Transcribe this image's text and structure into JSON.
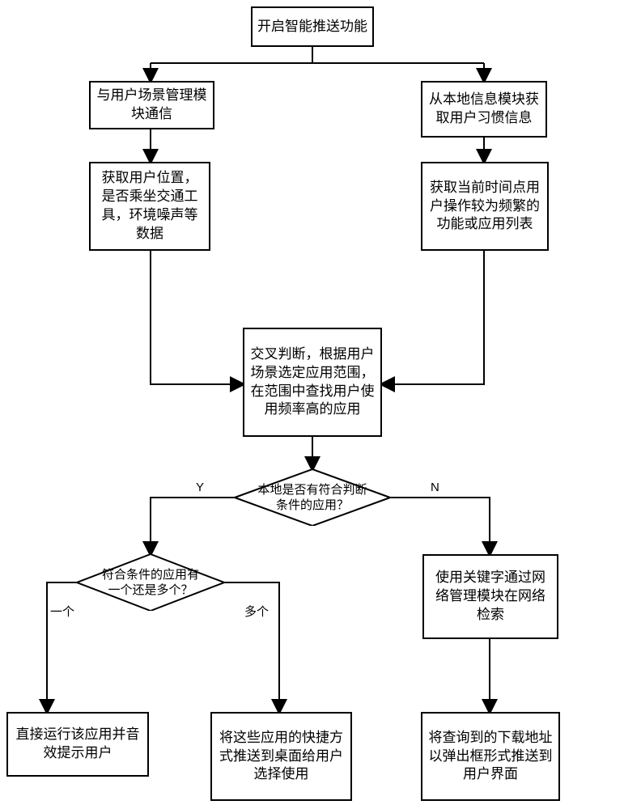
{
  "nodes": {
    "start": "开启智能推送功能",
    "left1": "与用户场景管理模块通信",
    "right1": "从本地信息模块获取用户习惯信息",
    "left2": "获取用户位置，是否乘坐交通工具，环境噪声等数据",
    "right2": "获取当前时间点用户操作较为频繁的功能或应用列表",
    "merge": "交叉判断，根据用户场景选定应用范围，在范围中查找用户使用频率高的应用",
    "decision1": "本地是否有符合判断条件的应用？",
    "decision2": "符合条件的应用有一个还是多个？",
    "netSearch": "使用关键字通过网络管理模块在网络检索",
    "outOne": "直接运行该应用并音效提示用户",
    "outMany": "将这些应用的快捷方式推送到桌面给用户选择使用",
    "outNet": "将查询到的下载地址以弹出框形式推送到用户界面"
  },
  "labels": {
    "yes": "Y",
    "no": "N",
    "one": "一个",
    "many": "多个"
  }
}
